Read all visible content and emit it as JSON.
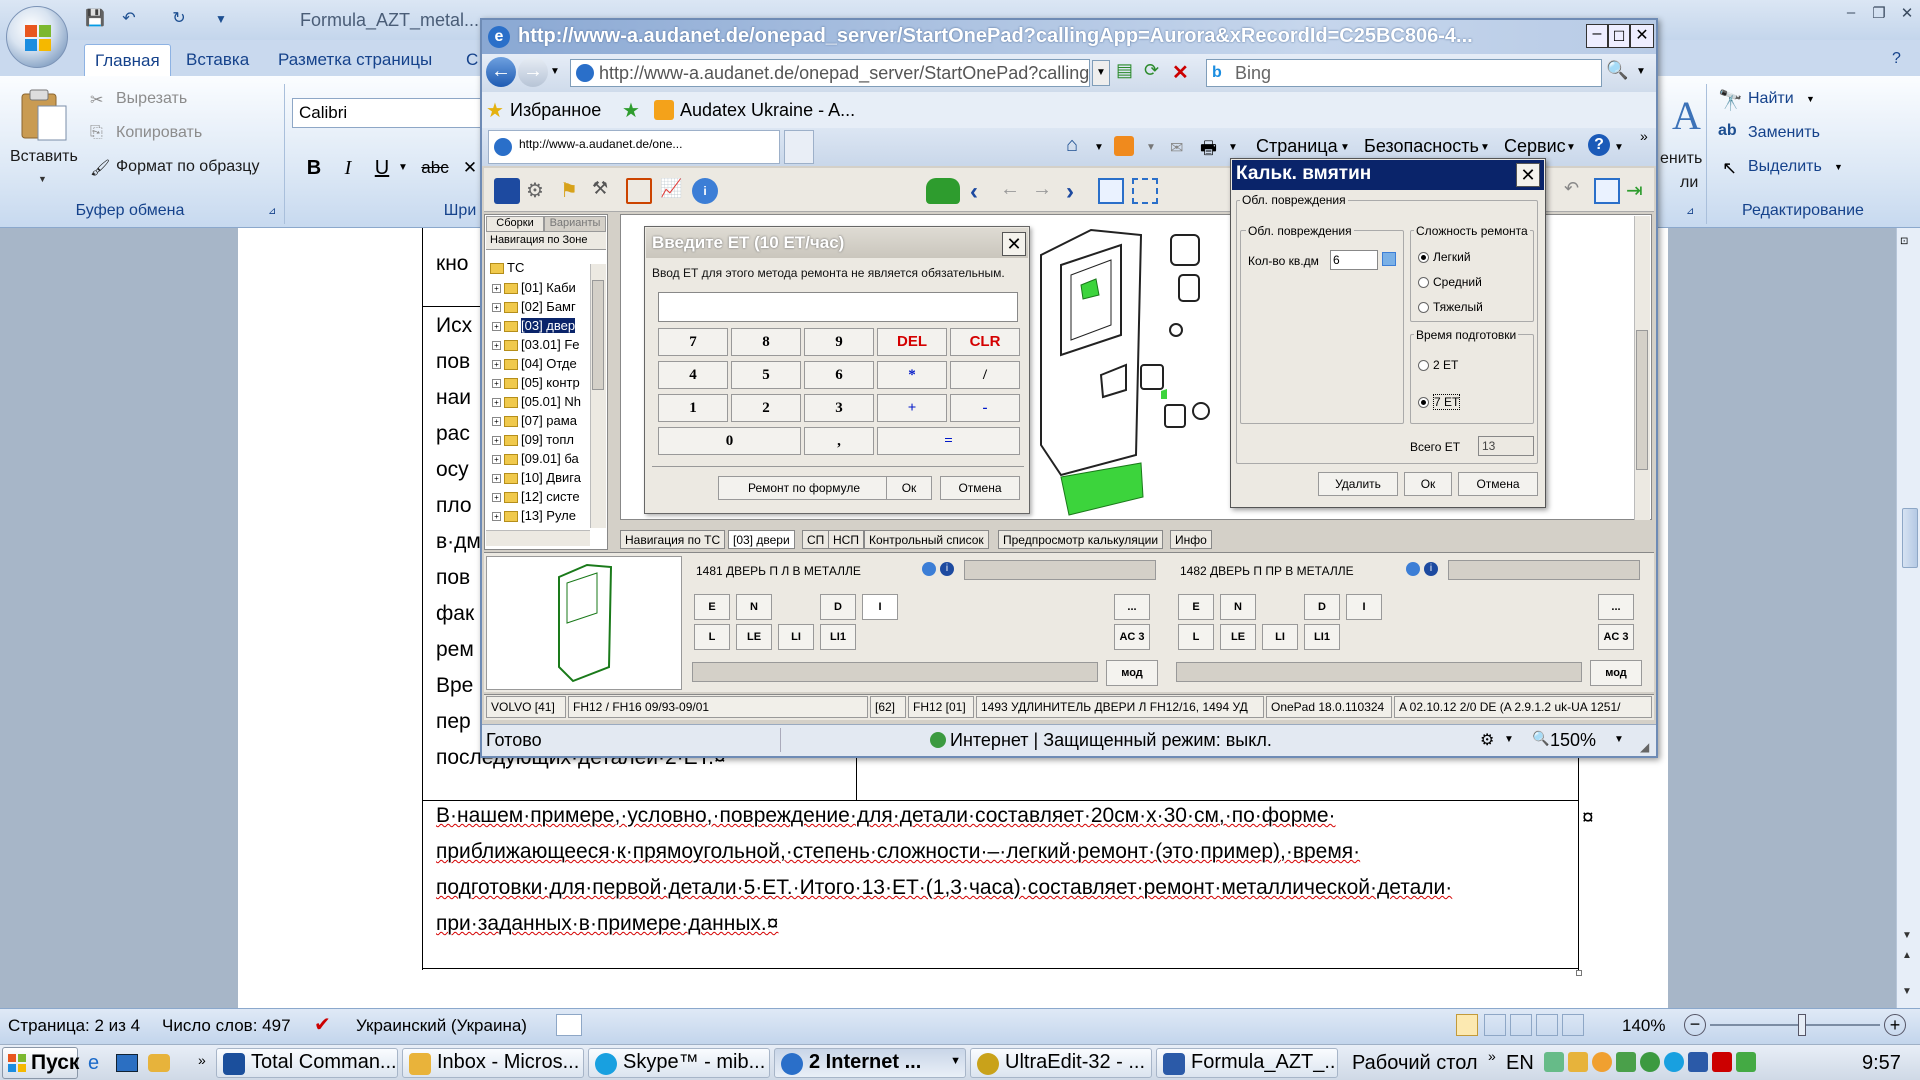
{
  "word": {
    "title": "Formula_AZT_metal...",
    "tabs": [
      "Главная",
      "Вставка",
      "Разметка страницы",
      "С"
    ],
    "clipboard": {
      "paste": "Вставить",
      "cut": "Вырезать",
      "copy": "Копировать",
      "format_painter": "Формат по образцу",
      "group_label": "Буфер обмена"
    },
    "font": {
      "name": "Calibri",
      "group_label": "Шри"
    },
    "editing": {
      "find": "Найти",
      "replace": "Заменить",
      "select": "Выделить",
      "group_label": "Редактирование"
    },
    "style_frag": [
      "енить",
      "ли"
    ],
    "doc": {
      "left_fragments": [
        "кно",
        "Исх",
        "пов",
        "наи",
        "рас",
        "осу",
        "пло",
        "в·дм",
        "пов",
        "фак",
        "рем",
        "Вре",
        "пер",
        "последующих·деталей·2·ЕТ.¤"
      ],
      "paragraph_lines": [
        "В·нашем·примере,·условно,·повреждение·для·детали·составляет·20см·х·30·см,·по·форме·",
        "приближающееся·к·прямоугольной,·степень·сложности·–·легкий·ремонт·(это·пример),·время·",
        "подготовки·для·первой·детали·5·ЕТ.·Итого·13·ЕТ·(1,3·часа)·составляет·ремонт·металлической·детали·",
        "при·заданных·в·примере·данных.¤"
      ],
      "cell_end": "¤"
    },
    "status": {
      "page": "Страница: 2 из 4",
      "words": "Число слов: 497",
      "language": "Украинский (Украина)",
      "zoom": "140%"
    }
  },
  "taskbar": {
    "start": "Пуск",
    "tasks": [
      {
        "label": "Total Comman...",
        "color": "#1b4f9c"
      },
      {
        "label": "Inbox - Micros...",
        "color": "#e9b33a"
      },
      {
        "label": "Skype™ - mib...",
        "color": "#18a0e0"
      },
      {
        "label": "2 Internet ...",
        "color": "#2a6fc9"
      },
      {
        "label": "UltraEdit-32 - ...",
        "color": "#c9a21a"
      },
      {
        "label": "Formula_AZT_...",
        "color": "#2b5aa8"
      }
    ],
    "desktop": "Рабочий стол",
    "lang": "EN",
    "clock": "9:57"
  },
  "ie": {
    "title": "http://www-a.audanet.de/onepad_server/StartOnePad?callingApp=Aurora&xRecordId=C25BC806-4...",
    "address": "http://www-a.audanet.de/onepad_server/StartOnePad?calling",
    "search": "Bing",
    "favorites": "Избранное",
    "fav_link": "Audatex Ukraine - A...",
    "tab": "http://www-a.audanet.de/one...",
    "menu": [
      "Страница",
      "Безопасность",
      "Сервис"
    ],
    "status": "Готово",
    "zone": "Интернет | Защищенный режим: выкл.",
    "zoom": "150%"
  },
  "onepad": {
    "nav_tabs": [
      "Сборки",
      "Варианты"
    ],
    "nav_header": "Навигация по Зоне",
    "tree_root": "TC",
    "tree": [
      "[01] Каби",
      "[02] Бамг",
      "[03] двер",
      "[03.01] Fe",
      "[04] Отде",
      "[05] контр",
      "[05.01] Nh",
      "[07] рама",
      "[09] топл",
      "[09.01] ба",
      "[10] Двига",
      "[12] систе",
      "[13] Руле"
    ],
    "sub_tabs": [
      "Навигация по ТС",
      "[03] двери",
      "СП",
      "НСП",
      "Контрольный список",
      "Предпросмотр калькуляции",
      "Инфо"
    ],
    "part1": {
      "name": "1481 ДВЕРЬ П Л В МЕТАЛЛЕ",
      "buttons": [
        "E",
        "N",
        "D",
        "I",
        "L",
        "LE",
        "LI",
        "LI1"
      ],
      "more": "...",
      "ac": "AC 3",
      "mod": "мод"
    },
    "part2": {
      "name": "1482 ДВЕРЬ П ПР В МЕТАЛЛЕ",
      "buttons": [
        "E",
        "N",
        "D",
        "I",
        "L",
        "LE",
        "LI",
        "LI1"
      ],
      "more": "...",
      "ac": "AC 3",
      "mod": "мод"
    },
    "status": [
      "VOLVO [41]",
      "FH12 / FH16 09/93-09/01",
      "[62]",
      "FH12 [01]",
      "1493 УДЛИНИТЕЛЬ ДВЕРИ Л FH12/16, 1494 УД",
      "OnePad 18.0.110324",
      "A 02.10.12 2/0 DE (A 2.9.1.2 uk-UA 1251/"
    ]
  },
  "et_dialog": {
    "title": "Введите ЕТ (10 ЕТ/час)",
    "hint": "Ввод ЕТ для этого метода ремонта не является обязательным.",
    "keys": [
      "7",
      "8",
      "9",
      "DEL",
      "CLR",
      "4",
      "5",
      "6",
      "*",
      "/",
      "1",
      "2",
      "3",
      "+",
      "-",
      "0",
      ",",
      "="
    ],
    "formula": "Ремонт по формуле",
    "ok": "Ок",
    "cancel": "Отмена"
  },
  "dent_dialog": {
    "title": "Кальк. вмятин",
    "outer_group": "Обл. повреждения",
    "area_group": "Обл. повреждения",
    "area_label": "Кол-во кв.дм",
    "area_value": "6",
    "complexity_group": "Сложность ремонта",
    "complexity": [
      "Легкий",
      "Средний",
      "Тяжелый"
    ],
    "complexity_selected": "Легкий",
    "prep_group": "Время подготовки",
    "prep": [
      "2 ЕТ",
      "7 ЕТ"
    ],
    "prep_selected": "7 ЕТ",
    "total_label": "Всего ЕТ",
    "total_value": "13",
    "delete": "Удалить",
    "ok": "Ок",
    "cancel": "Отмена"
  }
}
